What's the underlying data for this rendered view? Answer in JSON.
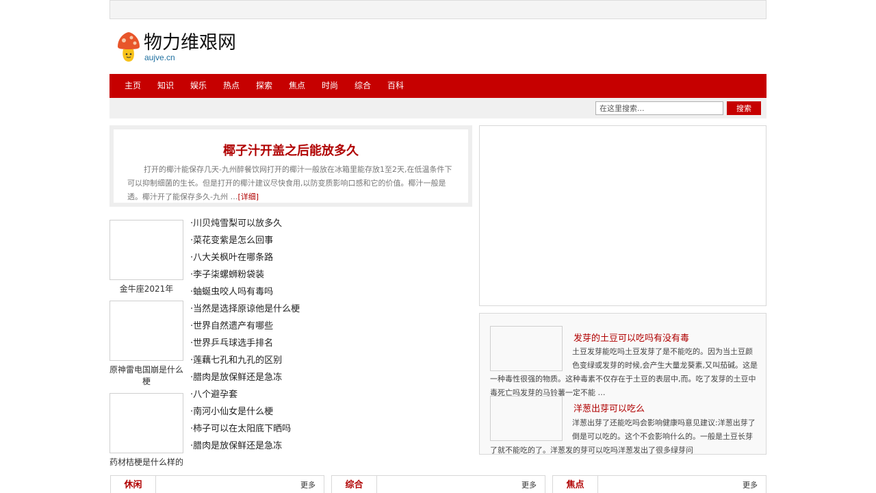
{
  "header": {
    "site_title": "物力维艰网",
    "site_domain": "aujve.cn",
    "logo_icon": "mushroom-icon"
  },
  "nav": {
    "items": [
      "主页",
      "知识",
      "娱乐",
      "热点",
      "探索",
      "焦点",
      "时尚",
      "综合",
      "百科"
    ]
  },
  "search": {
    "placeholder": "在这里搜索...",
    "button_label": "搜索"
  },
  "featured": {
    "title": "椰子汁开盖之后能放多久",
    "summary": "打开的椰汁能保存几天-九州醉餐饮网打开的椰汁一般放在冰箱里能存放1至2天,在低温条件下可以抑制细菌的生长。但是打开的椰汁建议尽快食用,以防变质影响口感和它的价值。椰汁一般是透。椰汁开了能保存多久-九州 …",
    "more_label": "[详细]"
  },
  "thumbnails": [
    {
      "caption": "金牛座2021年"
    },
    {
      "caption": "原神雷电国崩是什么梗"
    },
    {
      "caption": "药材桔梗是什么样的"
    }
  ],
  "title_list": [
    "·川贝炖雪梨可以放多久",
    "·菜花变紫是怎么回事",
    "·八大关枫叶在哪条路",
    "·李子柒螺蛳粉袋装",
    "·蚰蜒虫咬人吗有毒吗",
    "·当然是选择原谅他是什么梗",
    "·世界自然遗产有哪些",
    "·世界乒乓球选手排名",
    "·莲藕七孔和九孔的区别",
    "·腊肉是放保鲜还是急冻",
    "·八个避孕套",
    "·南河小仙女是什么梗",
    "·柿子可以在太阳底下晒吗",
    "·腊肉是放保鲜还是急冻"
  ],
  "side_articles": [
    {
      "title": "发芽的土豆可以吃吗有没有毒",
      "text": "土豆发芽能吃吗土豆发芽了是不能吃的。因为当土豆颜色变绿或发芽的时候,会产生大量龙葵素,又叫茄碱。这是一种毒性很强的物质。这种毒素不仅存在于土豆的表层中,而。吃了发芽的土豆中毒死亡吗发芽的马铃薯一定不能 …"
    },
    {
      "title": "洋葱出芽可以吃么",
      "text": "洋葱出芽了还能吃吗会影响健康吗意见建议:洋葱出芽了倒是可以吃的。这个不会影响什么的。一般是土豆长芽了就不能吃的了。洋葱发的芽可以吃吗洋葱发出了很多绿芽问"
    }
  ],
  "sections": [
    {
      "title": "休闲",
      "more": "更多"
    },
    {
      "title": "综合",
      "more": "更多"
    },
    {
      "title": "焦点",
      "more": "更多"
    }
  ],
  "colors": {
    "brand_red": "#c60000",
    "title_red": "#b00000",
    "domain_blue": "#1e6f9f"
  }
}
